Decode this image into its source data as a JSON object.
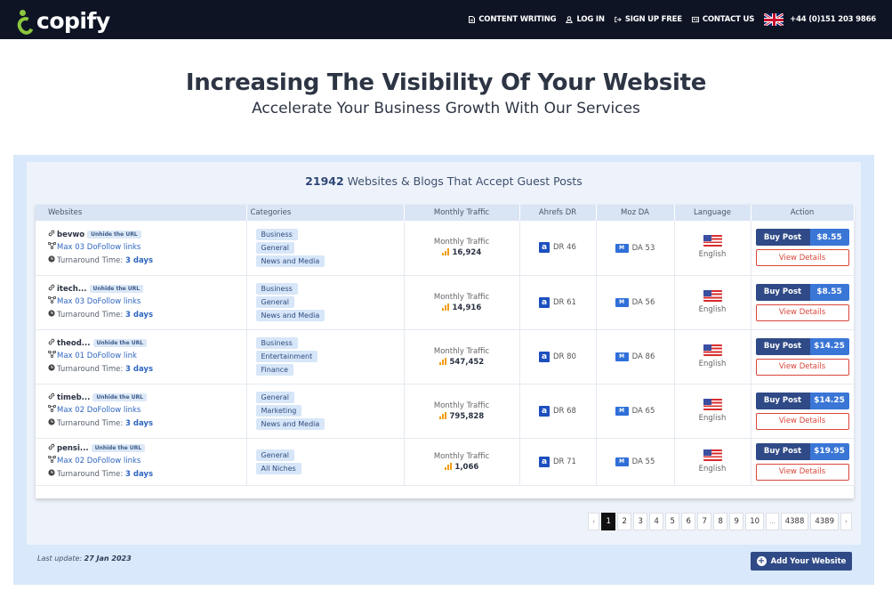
{
  "nav": {
    "logo_text": "copify",
    "links": [
      {
        "label": "CONTENT WRITING",
        "icon": "document-icon"
      },
      {
        "label": "LOG IN",
        "icon": "user-icon"
      },
      {
        "label": "SIGN UP FREE",
        "icon": "signup-icon"
      },
      {
        "label": "CONTACT US",
        "icon": "contact-icon"
      }
    ],
    "phone": "+44 (0)151 203 9866"
  },
  "hero": {
    "title": "Increasing The Visibility Of Your Website",
    "subtitle": "Accelerate Your Business Growth With Our Services"
  },
  "panel": {
    "count": "21942",
    "title_rest": " Websites & Blogs That Accept Guest Posts"
  },
  "table": {
    "headers": [
      "Websites",
      "Categories",
      "Monthly Traffic",
      "Ahrefs DR",
      "Moz DA",
      "Language",
      "Action"
    ],
    "traffic_label": "Monthly Traffic",
    "unhide_label": "Unhide the URL",
    "turnaround_label": "Turnaround Time:",
    "buy_label": "Buy Post",
    "view_label": "View Details",
    "rows": [
      {
        "site": "bevwo",
        "links": "Max 03 DoFollow links",
        "turnaround": "3 days",
        "categories": [
          "Business",
          "General",
          "News and Media"
        ],
        "traffic": "16,924",
        "dr": "DR 46",
        "da": "DA 53",
        "language": "English",
        "price": "$8.55"
      },
      {
        "site": "itech...",
        "links": "Max 03 DoFollow links",
        "turnaround": "3 days",
        "categories": [
          "Business",
          "General",
          "News and Media"
        ],
        "traffic": "14,916",
        "dr": "DR 61",
        "da": "DA 56",
        "language": "English",
        "price": "$8.55"
      },
      {
        "site": "theod...",
        "links": "Max 01 DoFollow link",
        "turnaround": "3 days",
        "categories": [
          "Business",
          "Entertainment",
          "Finance"
        ],
        "traffic": "547,452",
        "dr": "DR 80",
        "da": "DA 86",
        "language": "English",
        "price": "$14.25"
      },
      {
        "site": "timeb...",
        "links": "Max 02 DoFollow links",
        "turnaround": "3 days",
        "categories": [
          "General",
          "Marketing",
          "News and Media"
        ],
        "traffic": "795,828",
        "dr": "DR 68",
        "da": "DA 65",
        "language": "English",
        "price": "$14.25"
      },
      {
        "site": "pensi...",
        "links": "Max 02 DoFollow links",
        "turnaround": "3 days",
        "categories": [
          "General",
          "All Niches"
        ],
        "traffic": "1,066",
        "dr": "DR 71",
        "da": "DA 55",
        "language": "English",
        "price": "$19.95"
      }
    ]
  },
  "pagination": {
    "prev": "‹",
    "pages": [
      "1",
      "2",
      "3",
      "4",
      "5",
      "6",
      "7",
      "8",
      "9",
      "10",
      "...",
      "4388",
      "4389"
    ],
    "active": "1",
    "next": "›"
  },
  "footer": {
    "last_update_label": "Last update:",
    "last_update_date": "27 Jan 2023",
    "add_label": "Add Your Website"
  }
}
